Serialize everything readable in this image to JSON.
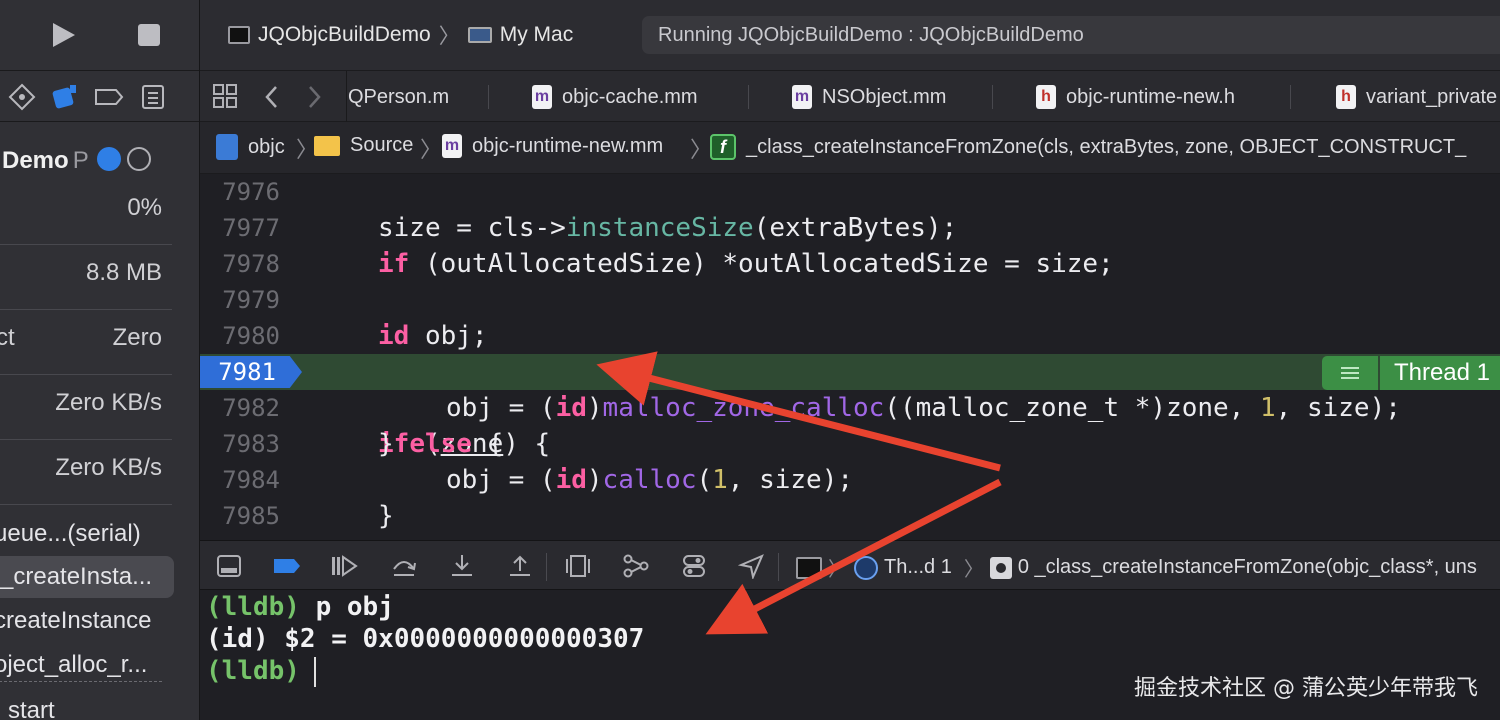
{
  "toolbar": {
    "scheme_target": "JQObjcBuildDemo",
    "destination": "My Mac",
    "activity_status": "Running JQObjcBuildDemo : JQObjcBuildDemo"
  },
  "navigator": {
    "process_name": "Demo",
    "process_suffix": "P",
    "gauges": [
      {
        "label": "",
        "value": "0%"
      },
      {
        "label": "",
        "value": "8.8 MB"
      },
      {
        "label": "ct",
        "value": "Zero"
      },
      {
        "label": "",
        "value": "Zero KB/s"
      },
      {
        "label": "",
        "value": "Zero KB/s"
      }
    ],
    "frames": [
      "ueue...(serial)",
      "_createInsta...",
      "createInstance",
      "oject_alloc_r...",
      "start"
    ]
  },
  "tabs": [
    {
      "label": "QPerson.m",
      "icon": "m"
    },
    {
      "label": "objc-cache.mm",
      "icon": "m"
    },
    {
      "label": "NSObject.mm",
      "icon": "m"
    },
    {
      "label": "objc-runtime-new.h",
      "icon": "h"
    },
    {
      "label": "variant_private",
      "icon": "h"
    }
  ],
  "jumpbar": {
    "project": "objc",
    "folder": "Source",
    "file": "objc-runtime-new.mm",
    "function": "_class_createInstanceFromZone(cls, extraBytes, zone, OBJECT_CONSTRUCT_"
  },
  "editor": {
    "line_numbers": [
      "7976",
      "7977",
      "7978",
      "7979",
      "7980",
      "7981",
      "7982",
      "7983",
      "7984",
      "7985"
    ],
    "code": {
      "l7977_a": "size = cls->",
      "l7977_fn": "instanceSize",
      "l7977_b": "(extraBytes);",
      "l7978_kw": "if",
      "l7978_b": " (outAllocatedSize) *outAllocatedSize = size;",
      "l7980_kw": "id",
      "l7980_b": " obj;",
      "l7981_kw": "if",
      "l7981_a": " (",
      "l7981_zone": "zone",
      "l7981_b": ") {",
      "l7982_a": "obj = (",
      "l7982_kw": "id",
      "l7982_b": ")",
      "l7982_fn": "malloc_zone_calloc",
      "l7982_c": "((malloc_zone_t *)zone, ",
      "l7982_num": "1",
      "l7982_d": ", size);",
      "l7983_a": "} ",
      "l7983_kw": "else",
      "l7983_b": " {",
      "l7984_a": "obj = (",
      "l7984_kw": "id",
      "l7984_b": ")",
      "l7984_fn": "calloc",
      "l7984_c": "(",
      "l7984_num": "1",
      "l7984_d": ", size);",
      "l7985": "}"
    },
    "current_line": "7981",
    "thread_label": "Thread 1"
  },
  "debugbar": {
    "thread": "Th...d 1",
    "frame": "0 _class_createInstanceFromZone(objc_class*, uns"
  },
  "console": {
    "line1_prompt": "(lldb)",
    "line1_cmd": " p obj",
    "line2": "(id) $2 = 0x0000000000000307",
    "line3_prompt": "(lldb)"
  },
  "watermark": "掘金技术社区 @ 蒲公英少年带我飞",
  "colors": {
    "accent_blue": "#2f6ed8",
    "highlight_green": "#2f4a33",
    "thread_green": "#3c8f45",
    "keyword_pink": "#fc5fa3",
    "arrow_red": "#e8432f"
  }
}
